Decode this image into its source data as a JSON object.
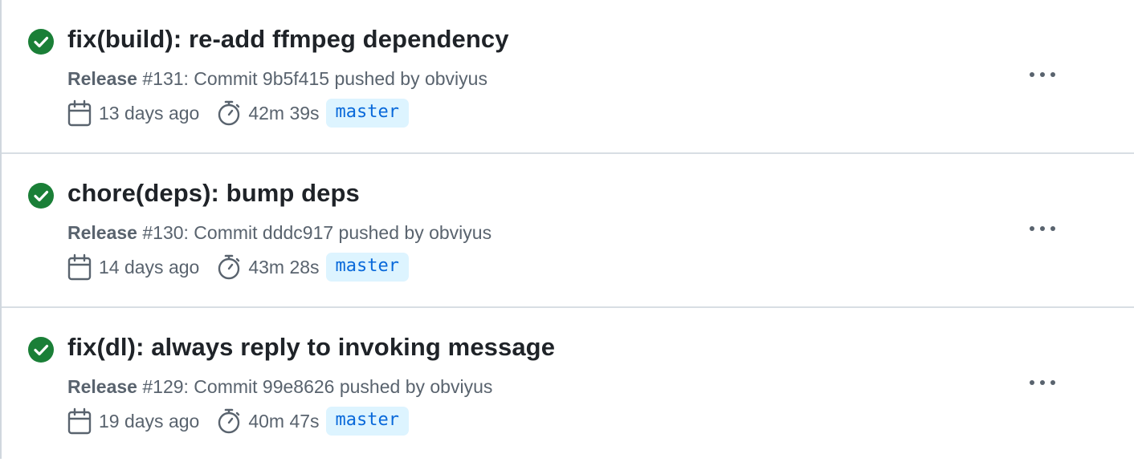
{
  "colors": {
    "success": "#1a7f37",
    "muted_text": "#59636e",
    "title_text": "#1f2328",
    "branch_text": "#0969da",
    "branch_bg": "#ddf4ff",
    "divider": "#d8dee4"
  },
  "icons": {
    "status": "check-circle-icon",
    "date": "calendar-icon",
    "duration": "stopwatch-icon",
    "menu": "kebab-horizontal-icon"
  },
  "runs": [
    {
      "title": "fix(build): re-add ffmpeg dependency",
      "workflow": "Release",
      "details": " #131: Commit 9b5f415 pushed by obviyus",
      "date": "13 days ago",
      "duration": "42m 39s",
      "branch": "master",
      "status": "success"
    },
    {
      "title": "chore(deps): bump deps",
      "workflow": "Release",
      "details": " #130: Commit dddc917 pushed by obviyus",
      "date": "14 days ago",
      "duration": "43m 28s",
      "branch": "master",
      "status": "success"
    },
    {
      "title": "fix(dl): always reply to invoking message",
      "workflow": "Release",
      "details": " #129: Commit 99e8626 pushed by obviyus",
      "date": "19 days ago",
      "duration": "40m 47s",
      "branch": "master",
      "status": "success"
    }
  ]
}
